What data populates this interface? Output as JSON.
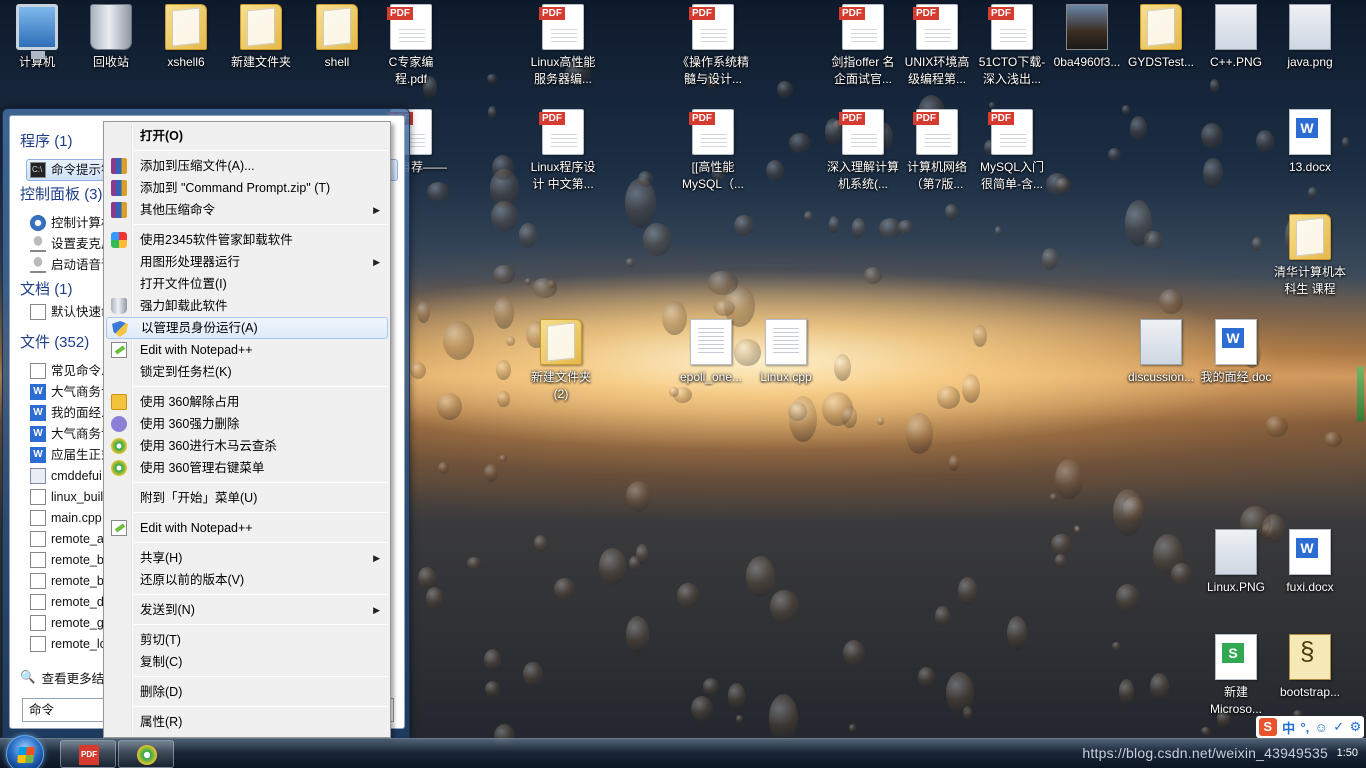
{
  "desktop": {
    "icons": [
      {
        "label": "计算机",
        "type": "pc"
      },
      {
        "label": "回收站",
        "type": "bin"
      },
      {
        "label": "xshell6",
        "type": "folder"
      },
      {
        "label": "新建文件夹",
        "type": "folder"
      },
      {
        "label": "shell",
        "type": "folder"
      },
      {
        "label": "C专家编程.pdf",
        "type": "pdf"
      },
      {
        "label": "Linux高性能服务器编...",
        "type": "pdf"
      },
      {
        "label": "《操作系统精髓与设计...",
        "type": "pdf"
      },
      {
        "label": "剑指offer 名企面试官...",
        "type": "pdf"
      },
      {
        "label": "UNIX环境高级编程第...",
        "type": "pdf"
      },
      {
        "label": "51CTO下载-深入浅出...",
        "type": "pdf"
      },
      {
        "label": "0ba4960f3...",
        "type": "photo"
      },
      {
        "label": "GYDSTest...",
        "type": "folder"
      },
      {
        "label": "C++.PNG",
        "type": "img"
      },
      {
        "label": "java.png",
        "type": "img"
      },
      {
        "label": "我的自荐——",
        "type": "pdf"
      },
      {
        "label": "Linux程序设计 中文第...",
        "type": "pdf"
      },
      {
        "label": "[[高性能MySQL（...",
        "type": "pdf"
      },
      {
        "label": "深入理解计算机系统(...",
        "type": "pdf"
      },
      {
        "label": "计算机网络（第7版...",
        "type": "pdf"
      },
      {
        "label": "MySQL入门很简单-含...",
        "type": "pdf"
      },
      {
        "label": "13.docx",
        "type": "word"
      },
      {
        "label": "清华计算机本科生 课程",
        "type": "folder"
      },
      {
        "label": "新建文件夹 (2)",
        "type": "folder"
      },
      {
        "label": "epoll_one...",
        "type": "doc"
      },
      {
        "label": "Linux.cpp",
        "type": "doc"
      },
      {
        "label": "discussion...",
        "type": "img"
      },
      {
        "label": "我的面经.doc",
        "type": "word"
      },
      {
        "label": "Linux.PNG",
        "type": "img"
      },
      {
        "label": "fuxi.docx",
        "type": "word"
      },
      {
        "label": "新建 Microso...",
        "type": "excel"
      },
      {
        "label": "bootstrap...",
        "type": "script"
      }
    ]
  },
  "start_menu": {
    "programs": {
      "title": "程序",
      "count": "(1)",
      "items": [
        {
          "label": "命令提示符",
          "icon": "cmd-icon"
        }
      ]
    },
    "control_panel": {
      "title": "控制面板",
      "count": "(3)",
      "items": [
        {
          "label": "控制计算机",
          "icon": "gear-icon"
        },
        {
          "label": "设置麦克风",
          "icon": "microphone-icon"
        },
        {
          "label": "启动语音识别",
          "icon": "microphone-icon"
        }
      ]
    },
    "documents": {
      "title": "文档",
      "count": "(1)",
      "items": [
        {
          "label": "默认快速命",
          "icon": "page-icon"
        }
      ]
    },
    "files": {
      "title": "文件",
      "count": "(352)",
      "items": [
        {
          "label": "常见命令.t",
          "icon": "page-icon"
        },
        {
          "label": "大气商务专",
          "icon": "word-icon"
        },
        {
          "label": "我的面经.d",
          "icon": "word-icon"
        },
        {
          "label": "大气商务专",
          "icon": "word-icon"
        },
        {
          "label": "应届生正式",
          "icon": "word-icon"
        },
        {
          "label": "cmddefui",
          "icon": "cmd-file-icon"
        },
        {
          "label": "linux_buil",
          "icon": "page-icon"
        },
        {
          "label": "main.cpp",
          "icon": "page-icon"
        },
        {
          "label": "remote_a",
          "icon": "page-icon"
        },
        {
          "label": "remote_b",
          "icon": "page-icon"
        },
        {
          "label": "remote_b",
          "icon": "page-icon"
        },
        {
          "label": "remote_d",
          "icon": "page-icon"
        },
        {
          "label": "remote_g",
          "icon": "page-icon"
        },
        {
          "label": "remote_lc",
          "icon": "page-icon"
        }
      ]
    },
    "see_more": "查看更多结果",
    "search_value": "命令"
  },
  "context_menu": {
    "items": [
      {
        "label": "打开(O)",
        "bold": true
      },
      {
        "sep": true
      },
      {
        "label": "添加到压缩文件(A)...",
        "icon": "rar"
      },
      {
        "label": "添加到 \"Command Prompt.zip\" (T)",
        "icon": "rar"
      },
      {
        "label": "其他压缩命令",
        "icon": "rar",
        "submenu": true
      },
      {
        "sep": true
      },
      {
        "label": "使用2345软件管家卸载软件",
        "icon": "2345"
      },
      {
        "label": "用图形处理器运行",
        "submenu": true
      },
      {
        "label": "打开文件位置(I)"
      },
      {
        "label": "强力卸载此软件",
        "icon": "bin"
      },
      {
        "label": "以管理员身份运行(A)",
        "icon": "shield",
        "highlight": true
      },
      {
        "label": "Edit with Notepad++",
        "icon": "npp"
      },
      {
        "label": "锁定到任务栏(K)"
      },
      {
        "sep": true
      },
      {
        "label": "使用 360解除占用",
        "icon": "360a"
      },
      {
        "label": "使用 360强力删除",
        "icon": "360b"
      },
      {
        "label": "使用 360进行木马云查杀",
        "icon": "360c"
      },
      {
        "label": "使用 360管理右键菜单",
        "icon": "360c"
      },
      {
        "sep": true
      },
      {
        "label": "附到「开始」菜单(U)"
      },
      {
        "sep": true
      },
      {
        "label": "Edit with Notepad++",
        "icon": "npp"
      },
      {
        "sep": true
      },
      {
        "label": "共享(H)",
        "submenu": true
      },
      {
        "label": "还原以前的版本(V)"
      },
      {
        "sep": true
      },
      {
        "label": "发送到(N)",
        "submenu": true
      },
      {
        "sep": true
      },
      {
        "label": "剪切(T)"
      },
      {
        "label": "复制(C)"
      },
      {
        "sep": true
      },
      {
        "label": "删除(D)"
      },
      {
        "sep": true
      },
      {
        "label": "属性(R)"
      }
    ]
  },
  "taskbar": {
    "buttons": [
      {
        "label": "PDF",
        "icon": "pdf-icon"
      },
      {
        "label": "",
        "icon": "360-icon"
      }
    ],
    "watermark": "https://blog.csdn.net/weixin_43949535",
    "clock": "1:50"
  },
  "ime": {
    "s": "S",
    "items": [
      "中",
      "°,",
      "☺",
      "✓",
      "⚙"
    ]
  }
}
